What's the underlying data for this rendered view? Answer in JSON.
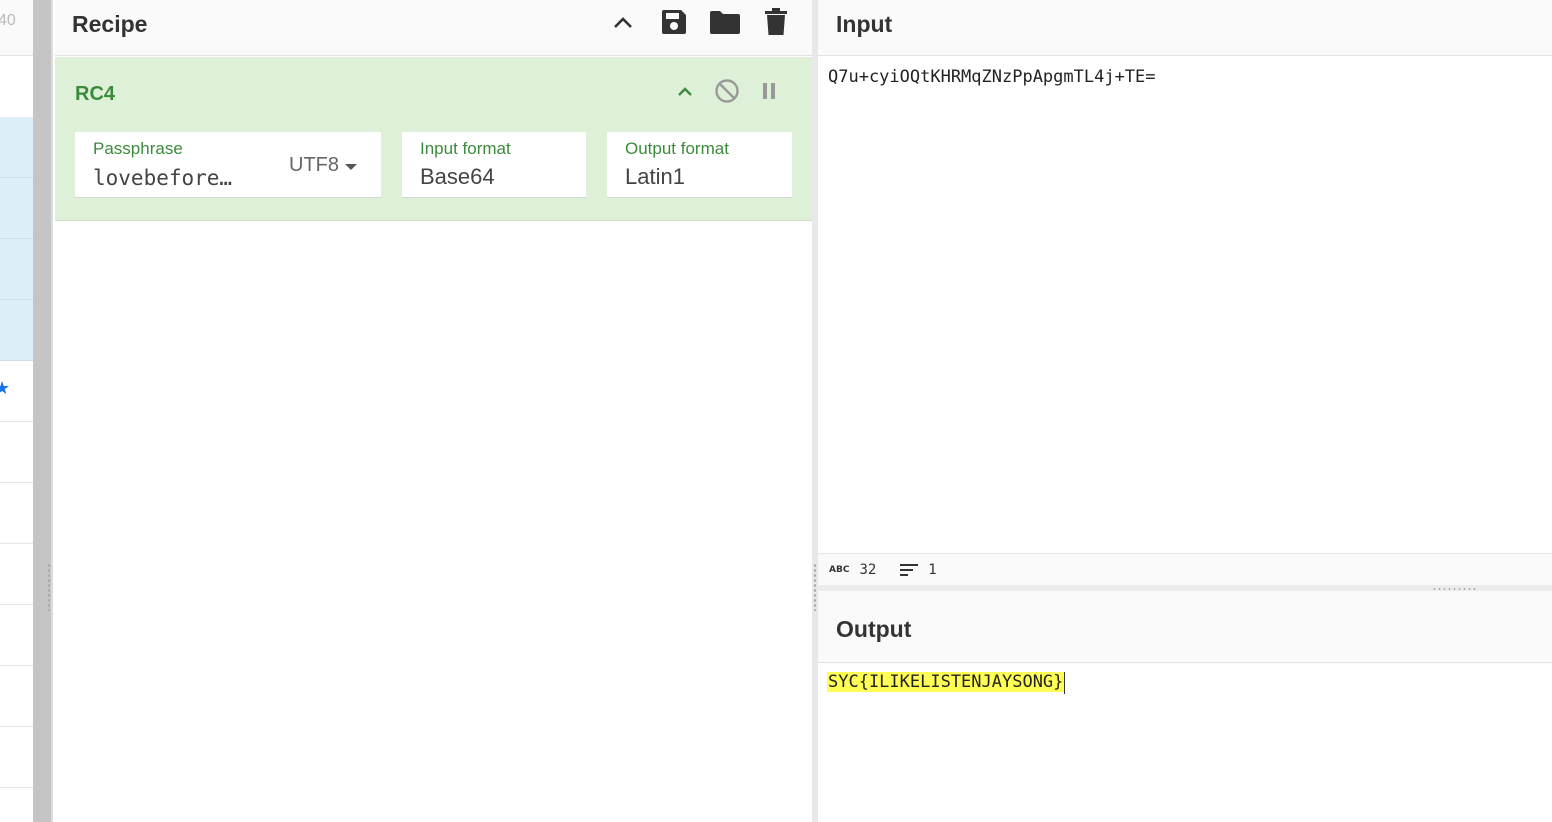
{
  "operations": {
    "count_fragment": "40"
  },
  "recipe": {
    "title": "Recipe",
    "operation": {
      "name": "RC4",
      "passphrase": {
        "label": "Passphrase",
        "value": "lovebefore…",
        "encoding": "UTF8"
      },
      "input_format": {
        "label": "Input format",
        "value": "Base64"
      },
      "output_format": {
        "label": "Output format",
        "value": "Latin1"
      }
    }
  },
  "input": {
    "title": "Input",
    "text": "Q7u+cyiOQtKHRMqZNzPpApgmTL4j+TE=",
    "status": {
      "length_icon": "ABC",
      "length": "32",
      "lines": "1"
    }
  },
  "output": {
    "title": "Output",
    "text": "SYC{ILIKELISTENJAYSONG}"
  },
  "colors": {
    "accent_green": "#3c8b3c",
    "operation_bg": "#dff0d8",
    "highlight": "#ffff55",
    "selected_row": "#deeef8"
  }
}
